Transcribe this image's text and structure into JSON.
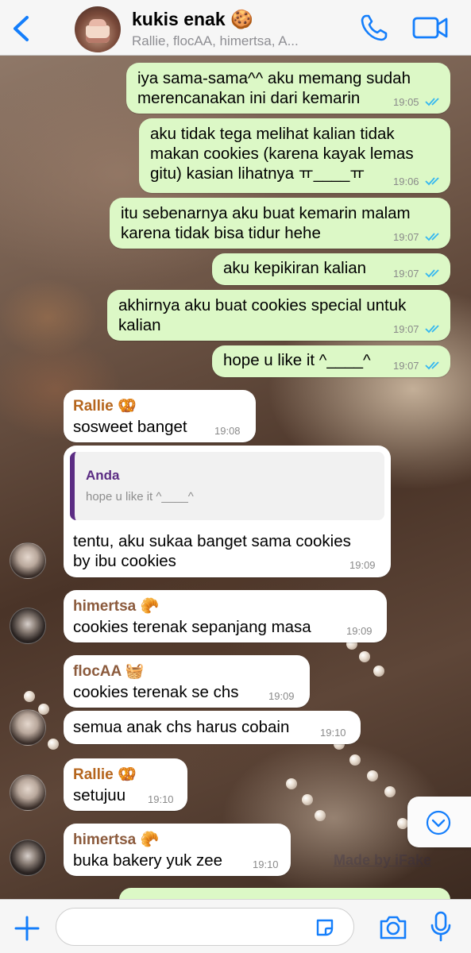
{
  "header": {
    "title": "kukis enak 🍪",
    "subtitle": "Rallie, flocAA, himertsa, A..."
  },
  "colors": {
    "accent": "#147efb",
    "outgoing": "#dcf8c6",
    "incoming": "#ffffff",
    "read_ticks": "#34b7f1"
  },
  "messages": [
    {
      "text": "iya sama-sama^^ aku memang sudah\nmerencanakan ini dari kemarin",
      "time": "19:05"
    },
    {
      "text": "aku tidak tega melihat kalian tidak\nmakan cookies (karena kayak lemas\ngitu) kasian lihatnya ㅠ____ㅠ",
      "time": "19:06"
    },
    {
      "text": "itu sebenarnya aku buat kemarin malam\nkarena tidak bisa tidur hehe",
      "time": "19:07"
    },
    {
      "text": "aku kepikiran kalian",
      "time": "19:07"
    },
    {
      "text": "akhirnya aku buat cookies special untuk\nkalian",
      "time": "19:07"
    },
    {
      "text": "hope u like it ^____^",
      "time": "19:07"
    },
    {
      "sender": "Rallie 🥨",
      "text": "sosweet banget",
      "time": "19:08"
    },
    {
      "quote_name": "Anda",
      "quote_text": "hope u like it ^____^",
      "text": "tentu, aku sukaa banget sama cookies\nby ibu cookies",
      "time": "19:09"
    },
    {
      "sender": "himertsa 🥐",
      "text": "cookies terenak sepanjang masa",
      "time": "19:09"
    },
    {
      "sender": "flocAA 🧺",
      "text": "cookies terenak se chs",
      "time": "19:09"
    },
    {
      "text": "semua anak chs harus cobain",
      "time": "19:10"
    },
    {
      "sender": "Rallie 🥨",
      "text": "setujuu",
      "time": "19:10"
    },
    {
      "sender": "himertsa 🥐",
      "text": "buka bakery yuk zee",
      "time": "19:10"
    }
  ],
  "sender_colors": {
    "rallie": "#b5651d",
    "himertsa": "#8b5a3c",
    "flocaa": "#8b5a3c"
  },
  "watermark": "Made by iFake",
  "input": {
    "placeholder": ""
  }
}
